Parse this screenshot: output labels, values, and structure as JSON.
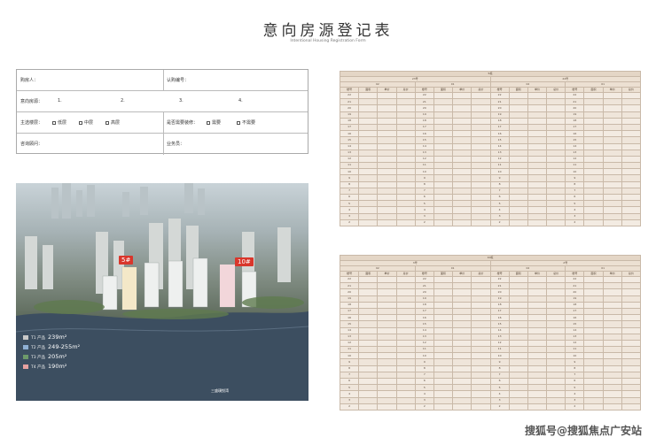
{
  "page": {
    "title": "意向房源登记表",
    "subtitle": "Intentional Housing Registration Form",
    "watermark": "搜狐号@搜狐焦点广安站"
  },
  "form": {
    "buyer_label": "购房人：",
    "id_label": "认购编号：",
    "intent_label": "意向房源：",
    "intent_slots": [
      "1.",
      "2.",
      "3.",
      "4."
    ],
    "floor_label": "主选楼层：",
    "floor_options": [
      "低层",
      "中层",
      "高层"
    ],
    "plan_label": "是否需要装修：",
    "plan_options": [
      "需要",
      "不需要"
    ],
    "consultant_label": "咨询顾问：",
    "salesman_label": "业务员："
  },
  "photo": {
    "tags": [
      "5#",
      "10#"
    ],
    "legend": [
      {
        "label": "T1 产品",
        "area": "239m²",
        "color": "#c9c9c9"
      },
      {
        "label": "T2 产品",
        "area": "249-255m²",
        "color": "#8fb0d4"
      },
      {
        "label": "T3 产品",
        "area": "205m²",
        "color": "#6e9a6a"
      },
      {
        "label": "T4 产品",
        "area": "190m²",
        "color": "#e7a1a0"
      }
    ],
    "logo": "三盛璞悦湾"
  },
  "table1": {
    "title": "5栋",
    "groups": [
      "23号",
      "24号"
    ],
    "units": [
      "02",
      "01",
      "02",
      "01"
    ],
    "columns": [
      "楼号",
      "面积",
      "单价",
      "总价",
      "楼号",
      "面积",
      "单价",
      "总价",
      "楼号",
      "面积",
      "单价",
      "总价",
      "楼号",
      "面积",
      "单价",
      "总价"
    ],
    "floors": [
      "22",
      "21",
      "20",
      "19",
      "18",
      "17",
      "16",
      "15",
      "14",
      "13",
      "12",
      "11",
      "10",
      "9",
      "8",
      "7",
      "6",
      "5",
      "4",
      "3",
      "2"
    ]
  },
  "table2": {
    "title": "10栋",
    "groups": [
      "3号",
      "2号"
    ],
    "units": [
      "02",
      "01",
      "02",
      "01"
    ],
    "columns": [
      "楼号",
      "面积",
      "单价",
      "总价",
      "楼号",
      "面积",
      "单价",
      "总价",
      "楼号",
      "面积",
      "单价",
      "总价",
      "楼号",
      "面积",
      "单价",
      "总价"
    ],
    "floors": [
      "22",
      "21",
      "20",
      "19",
      "18",
      "17",
      "16",
      "15",
      "14",
      "13",
      "12",
      "11",
      "10",
      "9",
      "8",
      "7",
      "6",
      "5",
      "4",
      "3",
      "2"
    ]
  }
}
